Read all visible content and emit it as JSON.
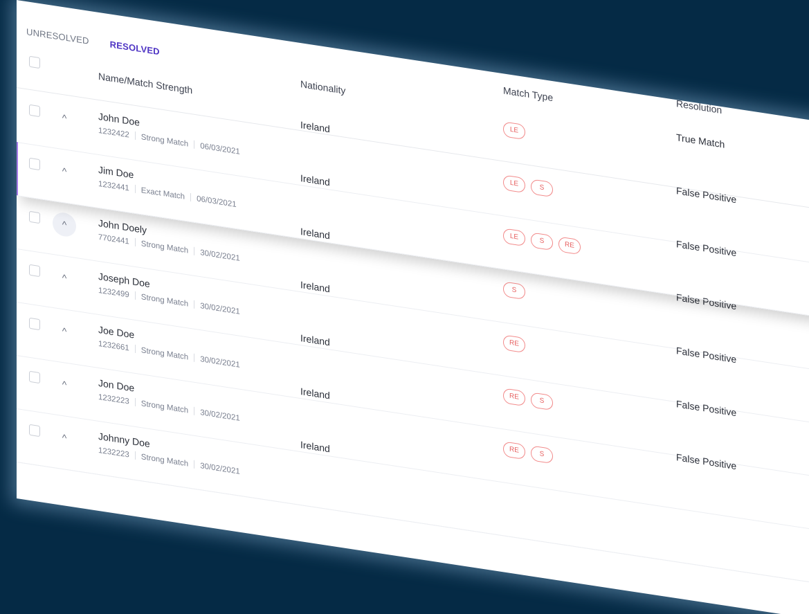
{
  "tabs": {
    "unresolved": "UNRESOLVED",
    "resolved": "RESOLVED"
  },
  "headers": {
    "name": "Name/Match Strength",
    "nationality": "Nationality",
    "match_type": "Match Type",
    "resolution": "Resolution"
  },
  "rows": [
    {
      "name": "John Doe",
      "id": "1232422",
      "strength": "Strong Match",
      "date": "06/03/2021",
      "nationality": "Ireland",
      "match_types": [
        "LE"
      ],
      "resolution": "True Match"
    },
    {
      "name": "Jim Doe",
      "id": "1232441",
      "strength": "Exact Match",
      "date": "06/03/2021",
      "nationality": "Ireland",
      "match_types": [
        "LE",
        "S"
      ],
      "resolution": "False Positive"
    },
    {
      "name": "John Doely",
      "id": "7702441",
      "strength": "Strong Match",
      "date": "30/02/2021",
      "nationality": "Ireland",
      "match_types": [
        "LE",
        "S",
        "RE"
      ],
      "resolution": "False Positive"
    },
    {
      "name": "Joseph Doe",
      "id": "1232499",
      "strength": "Strong Match",
      "date": "30/02/2021",
      "nationality": "Ireland",
      "match_types": [
        "S"
      ],
      "resolution": "False Positive"
    },
    {
      "name": "Joe Doe",
      "id": "1232661",
      "strength": "Strong Match",
      "date": "30/02/2021",
      "nationality": "Ireland",
      "match_types": [
        "RE"
      ],
      "resolution": "False Positive"
    },
    {
      "name": "Jon Doe",
      "id": "1232223",
      "strength": "Strong Match",
      "date": "30/02/2021",
      "nationality": "Ireland",
      "match_types": [
        "RE",
        "S"
      ],
      "resolution": "False Positive"
    },
    {
      "name": "Johnny Doe",
      "id": "1232223",
      "strength": "Strong Match",
      "date": "30/02/2021",
      "nationality": "Ireland",
      "match_types": [
        "RE",
        "S"
      ],
      "resolution": "False Positive"
    }
  ],
  "colors": {
    "background": "#052a45",
    "accent": "#4f35c4",
    "badge": "#e76262",
    "selection_bar": "#a87be8"
  },
  "icons": {
    "expand": "chevron-up-icon",
    "select": "checkbox"
  }
}
